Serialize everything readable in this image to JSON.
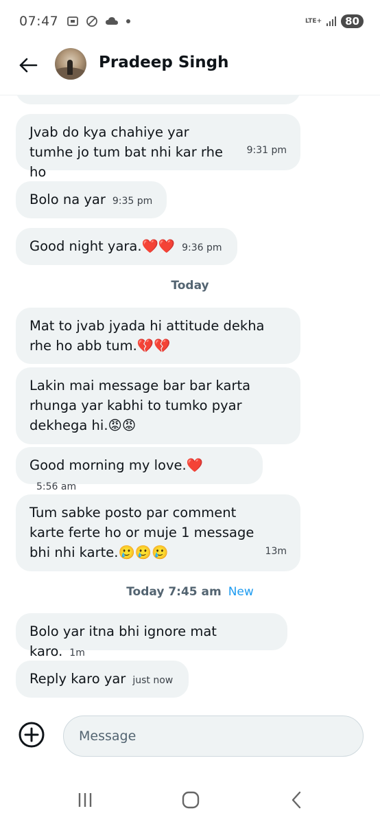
{
  "status_bar": {
    "time": "07:47",
    "network": "LTE+",
    "battery": "80"
  },
  "header": {
    "contact_name": "Pradeep Singh"
  },
  "messages": [
    {
      "text": "Jvab do kya chahiye yar tumhe jo tum bat nhi kar rhe ho",
      "time": "9:31 pm"
    },
    {
      "text": "Bolo na yar",
      "time": "9:35 pm"
    },
    {
      "text": "Good night yara.❤️❤️",
      "time": "9:36 pm"
    },
    {
      "text": "Mat to jvab jyada hi attitude dekha rhe ho abb tum.💔💔",
      "time": ""
    },
    {
      "text": "Lakin mai message bar bar karta rhunga yar kabhi to tumko pyar dekhega hi.😡😡",
      "time": ""
    },
    {
      "text": "Good morning my love.❤️",
      "time": "5:56 am"
    },
    {
      "text": "Tum sabke posto par comment karte ferte ho or muje 1 message bhi nhi karte.🥲🥲🥲",
      "time": "13m"
    },
    {
      "text": "Bolo yar itna bhi ignore mat karo.",
      "time": "1m"
    },
    {
      "text": "Reply karo yar",
      "time": "just now"
    }
  ],
  "separators": {
    "today": "Today",
    "today_time": "Today 7:45 am",
    "new_label": "New"
  },
  "composer": {
    "placeholder": "Message"
  },
  "colors": {
    "bubble": "#eff3f4",
    "accent": "#1d9bf0",
    "text": "#0f1419"
  }
}
